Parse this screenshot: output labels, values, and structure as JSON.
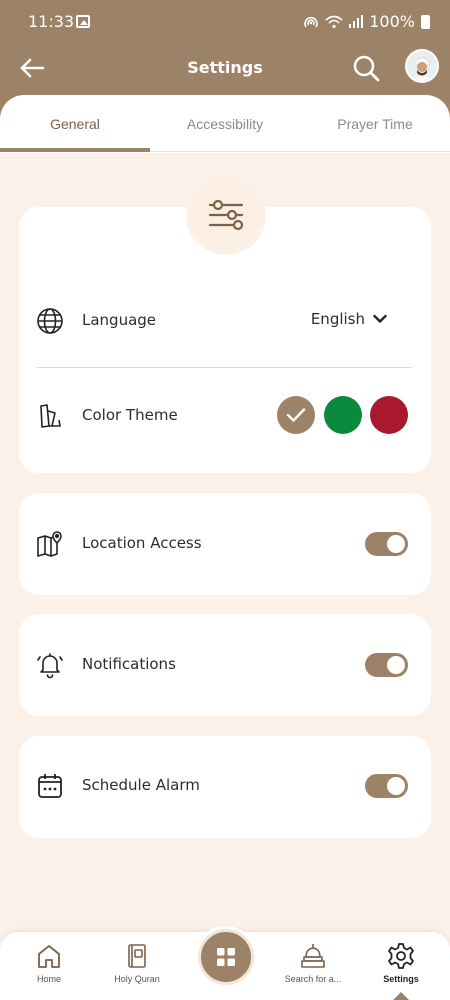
{
  "status_bar": {
    "time": "11:33",
    "battery": "100%"
  },
  "header": {
    "title": "Settings"
  },
  "tabs": [
    {
      "label": "General",
      "active": true
    },
    {
      "label": "Accessibility",
      "active": false
    },
    {
      "label": "Prayer Time",
      "active": false
    }
  ],
  "general": {
    "language": {
      "label": "Language",
      "value": "English"
    },
    "color_theme": {
      "label": "Color Theme",
      "options": [
        {
          "name": "brown",
          "color": "#9c8266",
          "selected": true
        },
        {
          "name": "green",
          "color": "#0b8a3e",
          "selected": false
        },
        {
          "name": "red",
          "color": "#a8182e",
          "selected": false
        }
      ]
    },
    "location_access": {
      "label": "Location Access",
      "enabled": true
    },
    "notifications": {
      "label": "Notifications",
      "enabled": true
    },
    "schedule_alarm": {
      "label": "Schedule Alarm",
      "enabled": true
    }
  },
  "bottom_nav": [
    {
      "label": "Home",
      "icon": "home-icon"
    },
    {
      "label": "Holy Quran",
      "icon": "book-icon"
    },
    {
      "label": "Search for a...",
      "icon": "mosque-icon"
    },
    {
      "label": "Settings",
      "icon": "gear-icon",
      "active": true
    }
  ],
  "colors": {
    "primary": "#9c8266",
    "background": "#fbf1e9"
  }
}
